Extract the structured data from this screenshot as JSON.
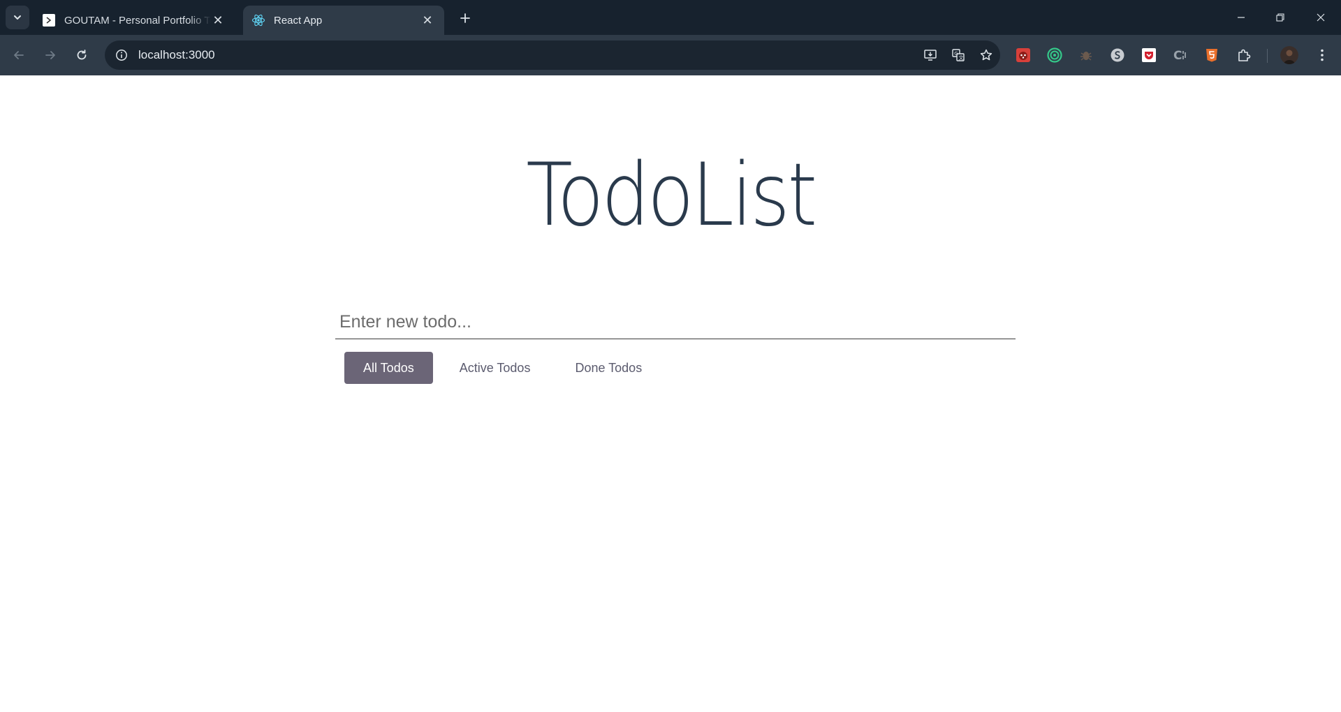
{
  "browser": {
    "tabs": [
      {
        "title": "GOUTAM - Personal Portfolio Template",
        "favicon": "page-favicon",
        "active": false
      },
      {
        "title": "React App",
        "favicon": "react-icon",
        "active": true
      }
    ],
    "url": "localhost:3000",
    "colors": {
      "tabstrip": "#17222e",
      "toolbar": "#2f3b48",
      "omnibox": "#1b2530"
    },
    "extensions": [
      "ladybug-icon",
      "target-icon",
      "bug-icon",
      "s-logo-icon",
      "pocket-icon",
      "css-icon",
      "html5-icon"
    ]
  },
  "app": {
    "title": "TodoList",
    "input": {
      "placeholder": "Enter new todo...",
      "value": ""
    },
    "filters": [
      {
        "label": "All Todos",
        "active": true
      },
      {
        "label": "Active Todos",
        "active": false
      },
      {
        "label": "Done Todos",
        "active": false
      }
    ],
    "colors": {
      "title": "#2a3a4c",
      "active_filter_bg": "#6b6577",
      "filter_text": "#5b5b6e"
    }
  }
}
